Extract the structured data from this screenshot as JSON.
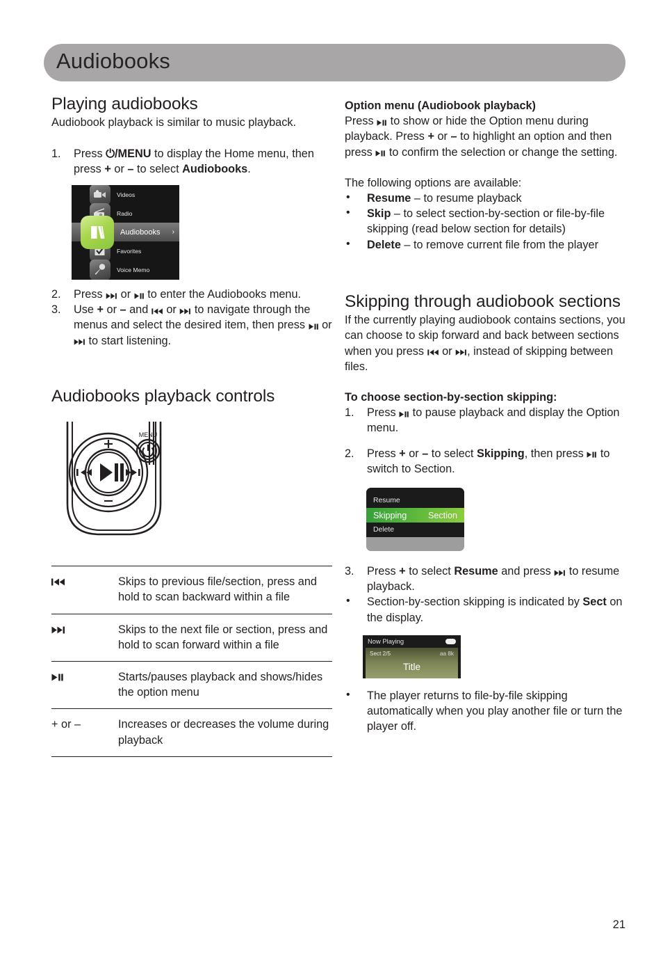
{
  "header": {
    "title": "Audiobooks",
    "bar_color": "#a8a6a7"
  },
  "page_number": "21",
  "left_column": {
    "playing": {
      "heading": "Playing audiobooks",
      "intro": "Audiobook playback is similar to music playback.",
      "steps": [
        {
          "num": "1.",
          "parts": [
            {
              "t": "Press "
            },
            {
              "t": "⏻/MENU",
              "b": true
            },
            {
              "t": " to display the Home menu, then press "
            },
            {
              "t": "+",
              "b": true
            },
            {
              "t": " or "
            },
            {
              "t": "–",
              "b": true
            },
            {
              "t": " to select "
            },
            {
              "t": "Audiobooks",
              "b": true
            },
            {
              "t": "."
            }
          ]
        },
        {
          "num": "2.",
          "parts": [
            {
              "t": "Press "
            },
            {
              "icon": "next-track-icon"
            },
            {
              "t": " or "
            },
            {
              "icon": "play-pause-icon"
            },
            {
              "t": " to enter the Audiobooks menu."
            }
          ]
        },
        {
          "num": "3.",
          "parts": [
            {
              "t": "Use "
            },
            {
              "t": "+",
              "b": true
            },
            {
              "t": " or "
            },
            {
              "t": "–",
              "b": true
            },
            {
              "t": " and "
            },
            {
              "icon": "prev-track-icon"
            },
            {
              "t": " or "
            },
            {
              "icon": "next-track-icon"
            },
            {
              "t": " to navigate through the menus and select the desired item, then press "
            },
            {
              "icon": "play-pause-icon"
            },
            {
              "t": " or "
            },
            {
              "icon": "next-track-icon"
            },
            {
              "t": " to start listening."
            }
          ]
        }
      ]
    },
    "home_menu_screenshot": {
      "items": [
        {
          "label": "Videos",
          "icon": "video-camera-icon",
          "selected": false
        },
        {
          "label": "Radio",
          "icon": "radio-antenna-icon",
          "selected": false
        },
        {
          "label": "Audiobooks",
          "icon": "book-icon",
          "selected": true,
          "chevron": "›"
        },
        {
          "label": "Favorites",
          "icon": "checkmark-box-icon",
          "selected": false
        },
        {
          "label": "Voice Memo",
          "icon": "microphone-icon",
          "selected": false
        }
      ],
      "highlight_color": "#8cc63f"
    },
    "controls": {
      "heading": "Audiobooks playback controls",
      "player_illustration": {
        "menu_label": "MENU",
        "power_icon": "power-icon",
        "plus_label": "+",
        "minus_label": "–",
        "prev_icon": "prev-track-icon",
        "next_icon": "next-track-icon",
        "playpause_icon": "play-pause-icon"
      },
      "table": [
        {
          "key_icon": "prev-track-icon",
          "key_text": "",
          "desc": "Skips to previous file/section, press and hold to scan backward within a file"
        },
        {
          "key_icon": "next-track-icon",
          "key_text": "",
          "desc": "Skips to the next file or section, press and hold to scan forward within a file"
        },
        {
          "key_icon": "play-pause-icon",
          "key_text": "",
          "desc": "Starts/pauses playback and shows/hides the option menu"
        },
        {
          "key_icon": "",
          "key_text": "+ or –",
          "desc": "Increases or decreases the volume during playback"
        }
      ]
    }
  },
  "right_column": {
    "option_menu": {
      "heading": "Option menu (Audiobook playback)",
      "para_parts": [
        {
          "t": "Press "
        },
        {
          "icon": "play-pause-icon"
        },
        {
          "t": " to show or hide the Option menu during playback. Press "
        },
        {
          "t": "+",
          "b": true
        },
        {
          "t": " or "
        },
        {
          "t": "–",
          "b": true
        },
        {
          "t": " to highlight an option and then press "
        },
        {
          "icon": "play-pause-icon"
        },
        {
          "t": " to confirm the selection or change the setting."
        }
      ],
      "options_intro": "The following options are available:",
      "options": [
        {
          "name": "Resume",
          "desc": " – to resume playback"
        },
        {
          "name": "Skip",
          "desc": " – to select section-by-section or file-by-file skipping (read below section for details)"
        },
        {
          "name": "Delete",
          "desc": " – to remove current file from the player"
        }
      ]
    },
    "skipping": {
      "heading": "Skipping through audiobook sections",
      "intro_parts": [
        {
          "t": "If the currently playing audiobook contains sections, you can choose to skip forward and back between sections when you press "
        },
        {
          "icon": "prev-track-icon"
        },
        {
          "t": " or "
        },
        {
          "icon": "next-track-icon"
        },
        {
          "t": ", instead of skipping between files."
        }
      ],
      "sub_heading": "To choose section-by-section skipping:",
      "steps": [
        {
          "num": "1.",
          "parts": [
            {
              "t": "Press "
            },
            {
              "icon": "play-pause-icon"
            },
            {
              "t": " to pause playback and display the Option menu."
            }
          ]
        },
        {
          "num": "2.",
          "parts": [
            {
              "t": "Press "
            },
            {
              "t": "+",
              "b": true
            },
            {
              "t": " or "
            },
            {
              "t": "–",
              "b": true
            },
            {
              "t": " to select "
            },
            {
              "t": "Skipping",
              "b": true
            },
            {
              "t": ", then press "
            },
            {
              "icon": "play-pause-icon"
            },
            {
              "t": " to switch to Section."
            }
          ]
        },
        {
          "num": "3.",
          "parts": [
            {
              "t": "Press "
            },
            {
              "t": "+",
              "b": true
            },
            {
              "t": " to select "
            },
            {
              "t": "Resume",
              "b": true
            },
            {
              "t": " and press "
            },
            {
              "icon": "next-track-icon"
            },
            {
              "t": " to resume playback."
            }
          ]
        }
      ],
      "bullets": [
        {
          "parts": [
            {
              "t": "Section-by-section skipping is indicated by "
            },
            {
              "t": "Sect",
              "b": true
            },
            {
              "t": " on the display."
            }
          ]
        },
        {
          "parts": [
            {
              "t": "The player returns to file-by-file skipping automatically when you play another file or turn the player off."
            }
          ]
        }
      ]
    },
    "option_menu_screenshot": {
      "rows": [
        {
          "label": "Resume",
          "value": "",
          "selected": false
        },
        {
          "label": "Skipping",
          "value": "Section",
          "selected": true
        },
        {
          "label": "Delete",
          "value": "",
          "selected": false
        }
      ],
      "highlight_color": "#6dbf3d"
    },
    "now_playing_screenshot": {
      "header": "Now Playing",
      "battery_icon": "battery-icon",
      "section": "Sect 2/5",
      "rate": "aa 8k",
      "title": "Title"
    }
  }
}
